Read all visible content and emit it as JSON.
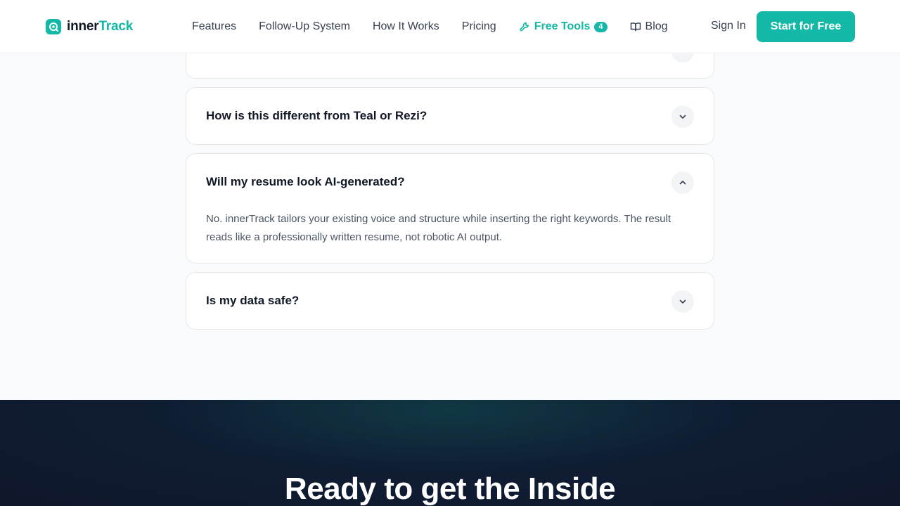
{
  "brand": {
    "name_part1": "inner",
    "name_part2": "Track",
    "accent_color": "#14b8a6"
  },
  "nav": {
    "items": [
      {
        "label": "Features"
      },
      {
        "label": "Follow-Up System"
      },
      {
        "label": "How It Works"
      },
      {
        "label": "Pricing"
      },
      {
        "label": "Free Tools",
        "badge": "4",
        "icon": "wrench-icon"
      },
      {
        "label": "Blog",
        "icon": "book-open-icon"
      }
    ],
    "signin_label": "Sign In",
    "cta_label": "Start for Free"
  },
  "faq": {
    "items": [
      {
        "question": "How is this different from Teal or Rezi?",
        "expanded": false
      },
      {
        "question": "Will my resume look AI-generated?",
        "expanded": true,
        "answer": "No. innerTrack tailors your existing voice and structure while inserting the right keywords. The result reads like a professionally written resume, not robotic AI output."
      },
      {
        "question": "Is my data safe?",
        "expanded": false
      }
    ]
  },
  "cta_section": {
    "title": "Ready to get the Inside"
  }
}
